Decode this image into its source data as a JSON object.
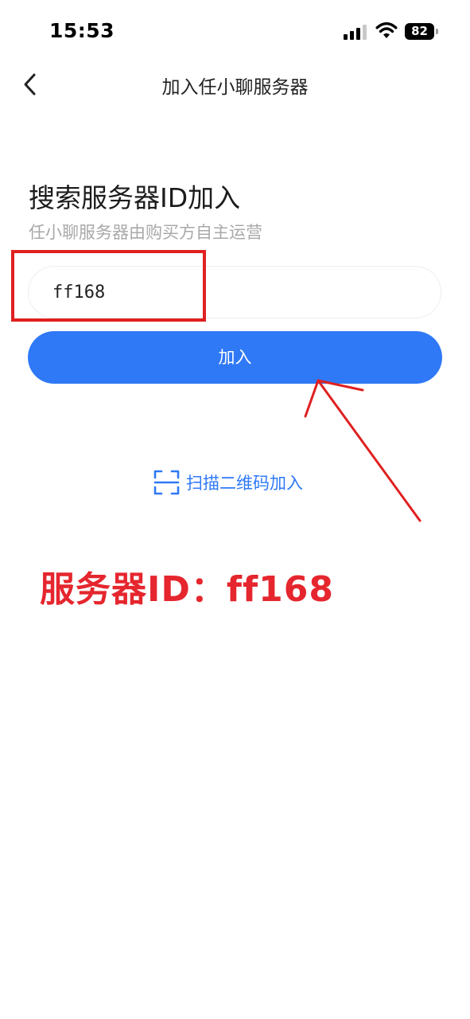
{
  "status_bar": {
    "time": "15:53",
    "battery_level": "82"
  },
  "nav": {
    "title": "加入任小聊服务器",
    "back_icon": "chevron-left-icon"
  },
  "main": {
    "heading": "搜索服务器ID加入",
    "subtitle": "任小聊服务器由购买方自主运营",
    "server_id_value": "ff168",
    "join_button_label": "加入",
    "scan_label": "扫描二维码加入",
    "scan_icon": "scan-qr-icon"
  },
  "annotation": {
    "text": "服务器ID：ff168",
    "color": "#e5262e"
  },
  "colors": {
    "accent": "#2f79f6",
    "highlight": "#e02020"
  }
}
